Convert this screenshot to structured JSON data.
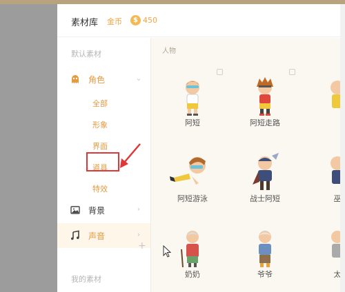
{
  "header": {
    "title": "素材库",
    "coin_label": "金币",
    "coin_glyph": "$",
    "coin_count": "450"
  },
  "sidebar": {
    "default_label": "默认素材",
    "categories": [
      {
        "label": "角色",
        "icon": "ghost-icon",
        "color": "#e59a3e"
      },
      {
        "label": "背景",
        "icon": "image-icon",
        "color": "#333333"
      },
      {
        "label": "声音",
        "icon": "music-note-icon",
        "color": "#e59a3e"
      }
    ],
    "role_sub_items": [
      "全部",
      "形象",
      "界面",
      "道具",
      "特效"
    ],
    "my_label": "我的素材"
  },
  "content": {
    "group_label": "人物",
    "cards": [
      "阿短",
      "阿短走路",
      "",
      "阿短游泳",
      "战士阿短",
      "巫",
      "奶奶",
      "爷爷",
      "太"
    ]
  },
  "colors": {
    "accent": "#e59a3e",
    "highlight": "#e03636",
    "content_bg": "#fbf7f1"
  }
}
